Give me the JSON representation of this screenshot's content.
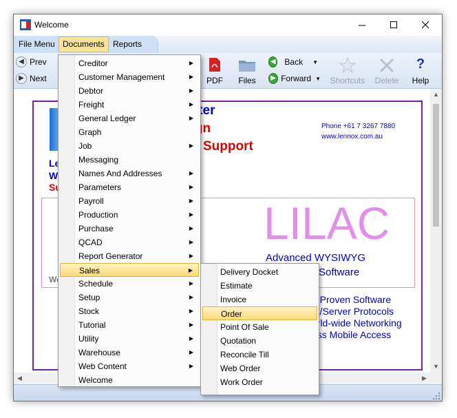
{
  "window": {
    "title": "Welcome"
  },
  "menubar": {
    "items": [
      "File Menu",
      "Documents",
      "Reports"
    ],
    "active": "Documents"
  },
  "toolbar": {
    "prev": "Prev",
    "next": "Next",
    "pdf": "PDF",
    "files": "Files",
    "back": "Back",
    "forward": "Forward",
    "shortcuts": "Shortcuts",
    "delete": "Delete",
    "help": "Help",
    "help_glyph": "?"
  },
  "page": {
    "heading1": "puter",
    "heading2": "sign",
    "heading3": "Support",
    "phone": "Phone +61 7 3267 7880",
    "web": "www.lennox.com.au",
    "side1": "Le",
    "side2": "W",
    "side3": "Su",
    "side4": "We",
    "lilac": "LILAC",
    "advanced": "Advanced WYSIWYG",
    "software": "Software",
    "bullet1": "t, Proven Software",
    "bullet2": "nt/Server Protocols",
    "bullet3": "orld-wide Networking",
    "bullet4": "ess Mobile Access"
  },
  "documents_menu": [
    {
      "label": "Creditor",
      "has_submenu": true
    },
    {
      "label": "Customer Management",
      "has_submenu": true
    },
    {
      "label": "Debtor",
      "has_submenu": true
    },
    {
      "label": "Freight",
      "has_submenu": true
    },
    {
      "label": "General Ledger",
      "has_submenu": true
    },
    {
      "label": "Graph",
      "has_submenu": false
    },
    {
      "label": "Job",
      "has_submenu": true
    },
    {
      "label": "Messaging",
      "has_submenu": false
    },
    {
      "label": "Names And Addresses",
      "has_submenu": true
    },
    {
      "label": "Parameters",
      "has_submenu": true
    },
    {
      "label": "Payroll",
      "has_submenu": true
    },
    {
      "label": "Production",
      "has_submenu": true
    },
    {
      "label": "Purchase",
      "has_submenu": true
    },
    {
      "label": "QCAD",
      "has_submenu": true
    },
    {
      "label": "Report Generator",
      "has_submenu": true
    },
    {
      "label": "Sales",
      "has_submenu": true
    },
    {
      "label": "Schedule",
      "has_submenu": true
    },
    {
      "label": "Setup",
      "has_submenu": true
    },
    {
      "label": "Stock",
      "has_submenu": true
    },
    {
      "label": "Tutorial",
      "has_submenu": true
    },
    {
      "label": "Utility",
      "has_submenu": true
    },
    {
      "label": "Warehouse",
      "has_submenu": true
    },
    {
      "label": "Web Content",
      "has_submenu": true
    },
    {
      "label": "Welcome",
      "has_submenu": false
    }
  ],
  "documents_highlighted": "Sales",
  "sales_menu": [
    "Delivery Docket",
    "Estimate",
    "Invoice",
    "Order",
    "Point Of Sale",
    "Quotation",
    "Reconcile Till",
    "Web Order",
    "Work Order"
  ],
  "sales_highlighted": "Order",
  "colors": {
    "accent_highlight": "#fbd978",
    "heading_blue": "#0000cc",
    "heading_red": "#e00000",
    "lilac": "#e090e8",
    "frame_purple": "#7a1fa2"
  }
}
